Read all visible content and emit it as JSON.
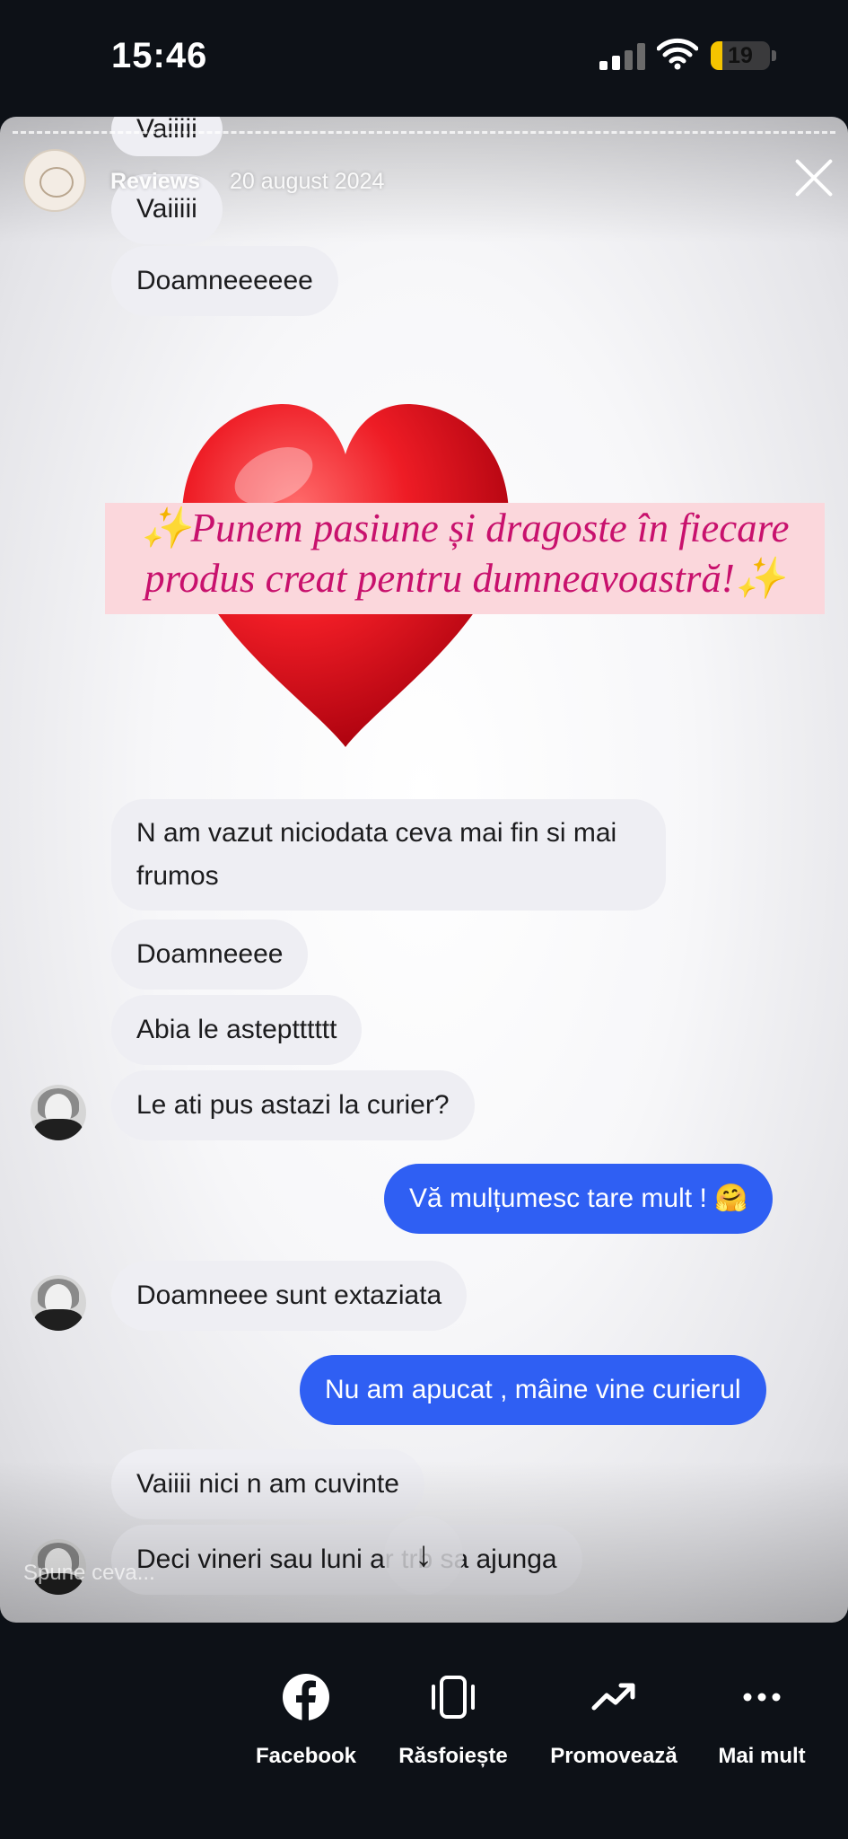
{
  "status_bar": {
    "time": "15:46",
    "battery": "19",
    "battery_level": 0.19,
    "signal_bars": 2
  },
  "story": {
    "account_name": "Reviews",
    "date": "20 august 2024",
    "caption_line1": "✨Punem pasiune și dragoste în fiecare",
    "caption_line2": "produs creat pentru dumneavoastră!✨",
    "reply_placeholder": "Spune ceva..."
  },
  "messages": [
    {
      "text": "Vaiiiii",
      "direction": "in"
    },
    {
      "text": "Vaiiiii",
      "direction": "in"
    },
    {
      "text": "Doamneeeeee",
      "direction": "in"
    },
    {
      "text": "N am vazut niciodata ceva mai fin si mai frumos",
      "direction": "in"
    },
    {
      "text": "Doamneeee",
      "direction": "in"
    },
    {
      "text": "Abia le asteptttttt",
      "direction": "in"
    },
    {
      "text": "Le ati pus astazi la curier?",
      "direction": "in"
    },
    {
      "text": "Vă mulțumesc tare mult ! 🤗",
      "direction": "out"
    },
    {
      "text": "Doamneee sunt extaziata",
      "direction": "in"
    },
    {
      "text": "Nu am apucat , mâine vine curierul",
      "direction": "out"
    },
    {
      "text": "Vaiiii nici n am cuvinte",
      "direction": "in"
    },
    {
      "text": "Deci vineri sau luni ar trb sa ajunga",
      "direction": "in"
    }
  ],
  "actions": [
    {
      "label": "Facebook",
      "icon": "facebook-icon"
    },
    {
      "label": "Răsfoiește",
      "icon": "phone-browse-icon"
    },
    {
      "label": "Promovează",
      "icon": "trending-up-icon"
    },
    {
      "label": "Mai mult",
      "icon": "more-dots-icon"
    }
  ],
  "colors": {
    "outgoing_bubble": "#2f5ff3",
    "incoming_bubble": "#eeeef3",
    "caption_text": "#c8116d",
    "caption_bg": "#fbd7dc",
    "battery": "#f5c400"
  }
}
